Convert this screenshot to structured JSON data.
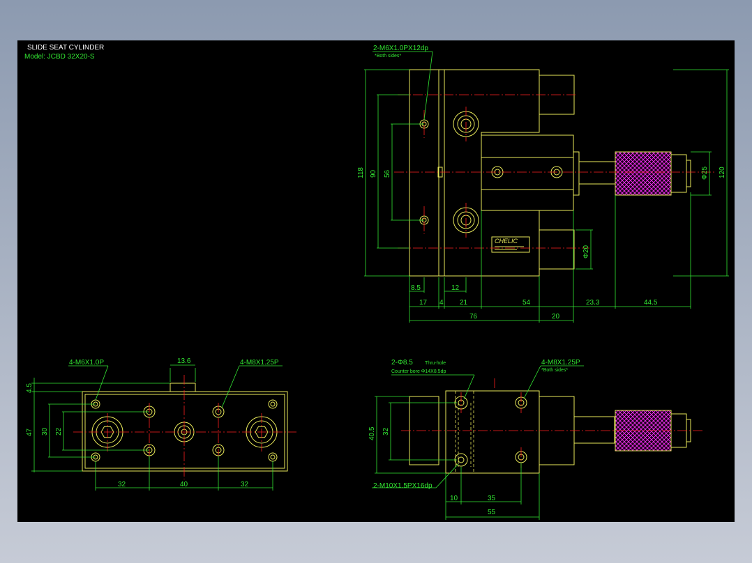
{
  "drawing": {
    "title": "SLIDE SEAT CYLINDER",
    "model": "Model: JCBD 32X20-S",
    "brand": "CHELIC"
  },
  "notes": {
    "top_tap": "2-M6X1.0PX12dp",
    "top_tap_sub": "*Both sides*",
    "bl_tap_left": "4-M6X1.0P",
    "bl_tap_right": "4-M8X1.25P",
    "br_hole": "2-Φ8.5",
    "br_hole_sub": "Thru-hole",
    "br_counterbore": "Counter bore  Φ14X8.5dp",
    "br_tap_right": "4-M8X1.25P",
    "br_tap_right_sub": "*Both sides*",
    "br_tap_bottom": "2-M10X1.5PX16dp"
  },
  "dims_top": {
    "h118": "118",
    "h90": "90",
    "h56": "56",
    "h120": "120",
    "d25": "Φ25",
    "d20": "Φ20",
    "b85": "8.5",
    "b12": "12",
    "b17": "17",
    "b4": "4",
    "b21": "21",
    "b54": "54",
    "b233": "23.3",
    "b445": "44.5",
    "b76": "76",
    "b20": "20"
  },
  "dims_bl": {
    "t136": "13.6",
    "v45": "4.5",
    "v47": "47",
    "v30": "30",
    "v22": "22",
    "b32a": "32",
    "b40": "40",
    "b32b": "32"
  },
  "dims_br": {
    "v405": "40.5",
    "v32": "32",
    "b10": "10",
    "b35": "35",
    "b55": "55"
  }
}
